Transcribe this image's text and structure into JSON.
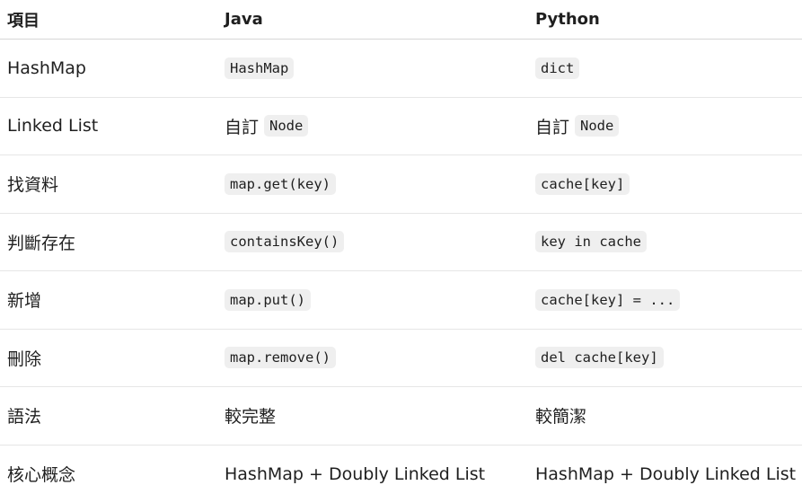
{
  "headers": [
    "項目",
    "Java",
    "Python"
  ],
  "rows": [
    {
      "item": "HashMap",
      "java": {
        "code": "HashMap"
      },
      "python": {
        "code": "dict"
      }
    },
    {
      "item": "Linked List",
      "java": {
        "prefix": "自訂",
        "code": "Node"
      },
      "python": {
        "prefix": "自訂",
        "code": "Node"
      }
    },
    {
      "item": "找資料",
      "java": {
        "code": "map.get(key)"
      },
      "python": {
        "code": "cache[key]"
      }
    },
    {
      "item": "判斷存在",
      "java": {
        "code": "containsKey()"
      },
      "python": {
        "code": "key in cache"
      }
    },
    {
      "item": "新增",
      "java": {
        "code": "map.put()"
      },
      "python": {
        "code": "cache[key] = ..."
      }
    },
    {
      "item": "刪除",
      "java": {
        "code": "map.remove()"
      },
      "python": {
        "code": "del cache[key]"
      }
    },
    {
      "item": "語法",
      "java": {
        "text": "較完整"
      },
      "python": {
        "text": "較簡潔"
      }
    },
    {
      "item": "核心概念",
      "java": {
        "text": "HashMap + Doubly Linked List"
      },
      "python": {
        "text": "HashMap + Doubly Linked List"
      }
    }
  ]
}
